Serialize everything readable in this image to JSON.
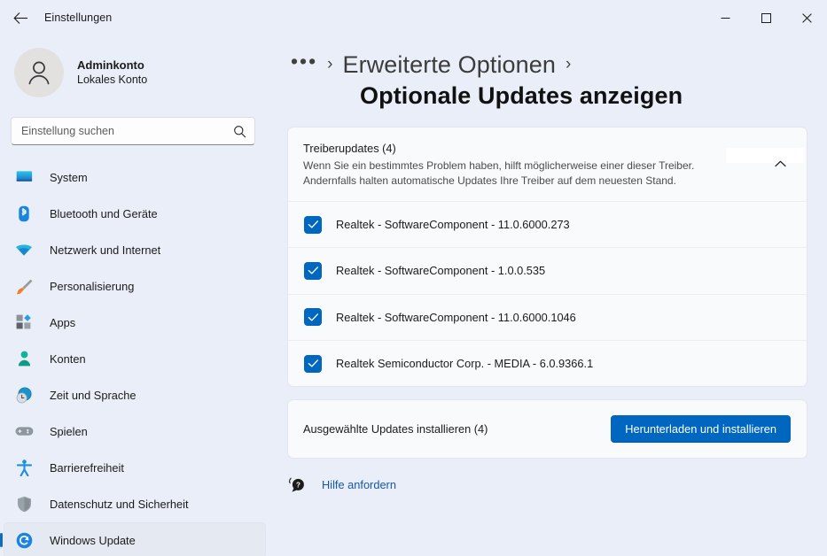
{
  "window": {
    "title": "Einstellungen",
    "back_icon": "back-arrow-icon",
    "minimize_label": "Minimieren",
    "maximize_label": "Maximieren",
    "close_label": "Schließen"
  },
  "account": {
    "name": "Adminkonto",
    "subtitle": "Lokales Konto",
    "avatar_icon": "person-icon"
  },
  "search": {
    "placeholder": "Einstellung suchen",
    "value": "",
    "icon": "search-icon"
  },
  "sidebar": {
    "items": [
      {
        "label": "System",
        "icon": "monitor-icon",
        "selected": false
      },
      {
        "label": "Bluetooth und Geräte",
        "icon": "bluetooth-icon",
        "selected": false
      },
      {
        "label": "Netzwerk und Internet",
        "icon": "wifi-icon",
        "selected": false
      },
      {
        "label": "Personalisierung",
        "icon": "paintbrush-icon",
        "selected": false
      },
      {
        "label": "Apps",
        "icon": "apps-icon",
        "selected": false
      },
      {
        "label": "Konten",
        "icon": "accounts-person-icon",
        "selected": false
      },
      {
        "label": "Zeit und Sprache",
        "icon": "clock-globe-icon",
        "selected": false
      },
      {
        "label": "Spielen",
        "icon": "gamepad-icon",
        "selected": false
      },
      {
        "label": "Barrierefreiheit",
        "icon": "accessibility-person-icon",
        "selected": false
      },
      {
        "label": "Datenschutz und Sicherheit",
        "icon": "shield-icon",
        "selected": false
      },
      {
        "label": "Windows Update",
        "icon": "windows-update-icon",
        "selected": true
      }
    ]
  },
  "breadcrumb": {
    "overflow": "•••",
    "separator": "›",
    "parent": "Erweiterte Optionen",
    "page_title": "Optionale Updates anzeigen"
  },
  "driver_card": {
    "title": "Treiberupdates (4)",
    "description_line1": "Wenn Sie ein bestimmtes Problem haben, hilft möglicherweise einer dieser Treiber.",
    "description_line2": "Andernfalls halten automatische Updates Ihre Treiber auf dem neuesten Stand.",
    "collapse_icon": "chevron-up-icon",
    "updates": [
      {
        "label": "Realtek - SoftwareComponent - 11.0.6000.273",
        "checked": true
      },
      {
        "label": "Realtek - SoftwareComponent - 1.0.0.535",
        "checked": true
      },
      {
        "label": "Realtek - SoftwareComponent - 11.0.6000.1046",
        "checked": true
      },
      {
        "label": "Realtek Semiconductor Corp. - MEDIA - 6.0.9366.1",
        "checked": true
      }
    ]
  },
  "install_card": {
    "label": "Ausgewählte Updates installieren (4)",
    "button": "Herunterladen und installieren"
  },
  "help": {
    "icon": "help-bubble-icon",
    "link": "Hilfe anfordern"
  },
  "colors": {
    "background": "#eaeef8",
    "card": "#f8fafb",
    "accent": "#0067c0",
    "link": "#1558a8",
    "selected_nav": "#e5e9f2",
    "nav_indicator": "#0f6cbd"
  }
}
